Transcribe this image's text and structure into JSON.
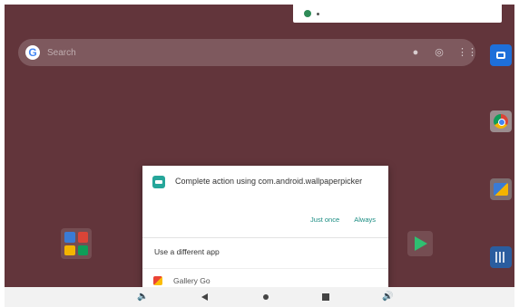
{
  "search": {
    "placeholder": "Search"
  },
  "dialog": {
    "title": "Complete action using com.android.wallpaperpicker",
    "just_once": "Just once",
    "always": "Always",
    "use_different_app": "Use a different app",
    "apps": [
      {
        "label": "Gallery Go"
      }
    ]
  },
  "colors": {
    "wallpaper": "#6b3a40",
    "accent": "#1a8c82",
    "dialog_icon": "#26a69a"
  },
  "icons": {
    "search_bar": [
      "google-g-icon",
      "mic-icon",
      "lens-icon",
      "apps-grid-icon"
    ],
    "dock": [
      "camera-app-icon",
      "chrome-app-icon",
      "gallery-app-icon",
      "calculator-app-icon"
    ],
    "navigation": [
      "volume-down-icon",
      "back-icon",
      "home-icon",
      "recents-icon",
      "volume-up-icon"
    ]
  }
}
